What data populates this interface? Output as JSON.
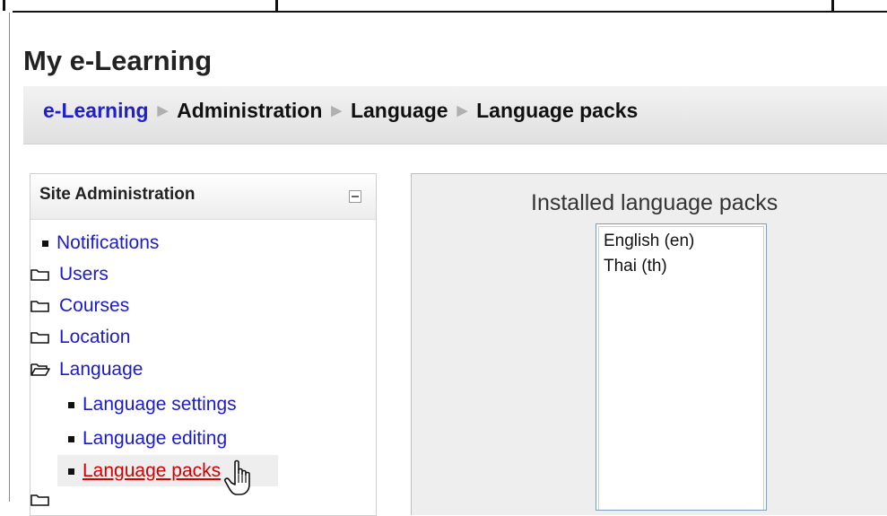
{
  "site": {
    "title": "My e-Learning"
  },
  "breadcrumb": {
    "items": [
      {
        "label": "e-Learning",
        "link": true
      },
      {
        "label": "Administration",
        "link": false
      },
      {
        "label": "Language",
        "link": false
      },
      {
        "label": "Language packs",
        "link": false
      }
    ]
  },
  "admin_block": {
    "title": "Site Administration",
    "items": [
      {
        "label": "Notifications",
        "icon": "bullet-icon"
      },
      {
        "label": "Users",
        "icon": "folder-icon"
      },
      {
        "label": "Courses",
        "icon": "folder-icon"
      },
      {
        "label": "Location",
        "icon": "folder-icon"
      },
      {
        "label": "Language",
        "icon": "folder-open-icon"
      },
      {
        "label": "Language settings",
        "icon": "bullet-icon"
      },
      {
        "label": "Language editing",
        "icon": "bullet-icon"
      },
      {
        "label": "Language packs",
        "icon": "bullet-icon",
        "current": true
      }
    ]
  },
  "language_packs": {
    "heading": "Installed language packs",
    "options": [
      "English (en)",
      "Thai (th)"
    ]
  },
  "colors": {
    "link": "#1a1acf",
    "current": "#d40000",
    "panel_bg": "#eeeeee"
  }
}
